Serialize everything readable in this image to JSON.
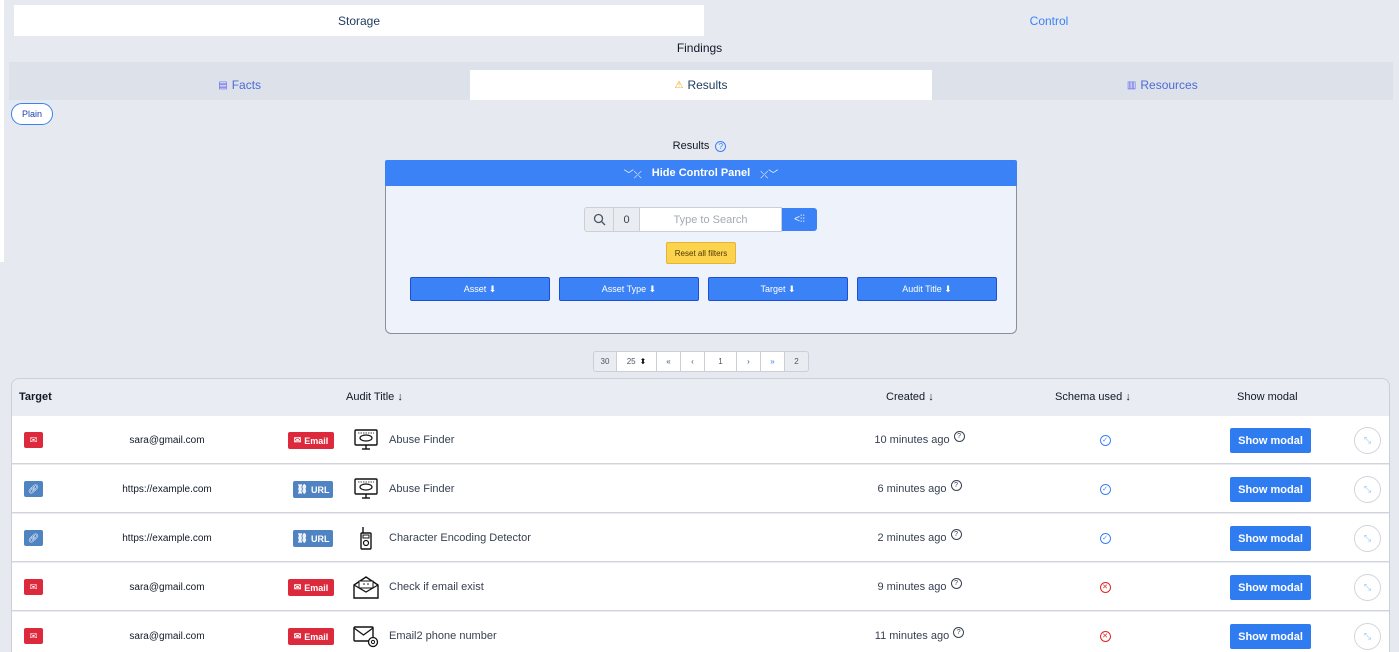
{
  "top_tabs": [
    {
      "label": "Storage",
      "active": true
    },
    {
      "label": "Control",
      "active": false
    }
  ],
  "findings_title": "Findings",
  "sub_tabs": [
    {
      "label": "Facts",
      "icon": "list-icon",
      "active": false
    },
    {
      "label": "Results",
      "icon": "warning-icon",
      "active": true
    },
    {
      "label": "Resources",
      "icon": "books-icon",
      "active": false
    }
  ],
  "plain_label": "Plain",
  "results_title": "Results",
  "control_bar_label": "Hide Control Panel",
  "search": {
    "count": "0",
    "placeholder": "Type to Search"
  },
  "reset_label": "Reset all filters",
  "filters": [
    "Asset ⬇",
    "Asset Type ⬇",
    "Target ⬇",
    "Audit Title ⬇"
  ],
  "pager": {
    "total": "30",
    "page_size": "25",
    "first": "«",
    "prev": "‹",
    "current": "1",
    "next": "›",
    "last": "»",
    "pages": "2"
  },
  "table": {
    "headers": {
      "target": "Target",
      "audit_title": "Audit Title ↓",
      "created": "Created ↓",
      "schema": "Schema used ↓",
      "modal": "Show modal"
    },
    "show_modal_label": "Show modal",
    "rows": [
      {
        "type": "email",
        "target": "sara@gmail.com",
        "badge": "Email",
        "audit_icon": "monitor-icon",
        "audit": "Abuse Finder",
        "created": "10 minutes ago",
        "schema": "ok"
      },
      {
        "type": "url",
        "target": "https://example.com",
        "badge": "URL",
        "audit_icon": "monitor-icon",
        "audit": "Abuse Finder",
        "created": "6 minutes ago",
        "schema": "ok"
      },
      {
        "type": "url",
        "target": "https://example.com",
        "badge": "URL",
        "audit_icon": "walkie-talkie-icon",
        "audit": "Character Encoding Detector",
        "created": "2 minutes ago",
        "schema": "ok"
      },
      {
        "type": "email",
        "target": "sara@gmail.com",
        "badge": "Email",
        "audit_icon": "open-envelope-icon",
        "audit": "Check if email exist",
        "created": "9 minutes ago",
        "schema": "error"
      },
      {
        "type": "email",
        "target": "sara@gmail.com",
        "badge": "Email",
        "audit_icon": "envelope-at-icon",
        "audit": "Email2 phone number",
        "created": "11 minutes ago",
        "schema": "error"
      }
    ]
  },
  "colors": {
    "primary": "#3b82f6",
    "email_red": "#dc2a3c",
    "url_blue": "#4f83c2",
    "reset_yellow": "#fcd34d"
  }
}
